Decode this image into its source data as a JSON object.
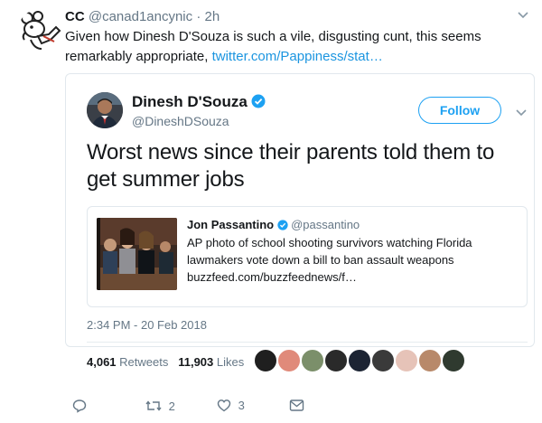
{
  "outer_tweet": {
    "display_name": "CC",
    "handle": "@canad1ancynic",
    "time": "· 2h",
    "text": "Given how Dinesh D'Souza is such a vile, disgusting cunt, this seems remarkably appropriate, ",
    "link_text": "twitter.com/Pappiness/stat…"
  },
  "quoted_tweet": {
    "display_name": "Dinesh D'Souza",
    "handle": "@DineshDSouza",
    "follow_label": "Follow",
    "text": "Worst news since their parents told them to get summer jobs",
    "timestamp": "2:34 PM - 20 Feb 2018",
    "retweets_count": "4,061",
    "retweets_label": "Retweets",
    "likes_count": "11,903",
    "likes_label": "Likes"
  },
  "inner_tweet": {
    "display_name": "Jon Passantino",
    "handle": "@passantino",
    "text": "AP photo of school shooting survivors watching Florida lawmakers vote down a bill to ban assault weapons",
    "link": "buzzfeed.com/buzzfeednews/f…"
  },
  "actions": {
    "reply_count": "",
    "retweet_count": "2",
    "like_count": "3",
    "dm_count": ""
  },
  "colors": {
    "link": "#1b95e0",
    "verified": "#1da1f2",
    "secondary_text": "#657786"
  }
}
